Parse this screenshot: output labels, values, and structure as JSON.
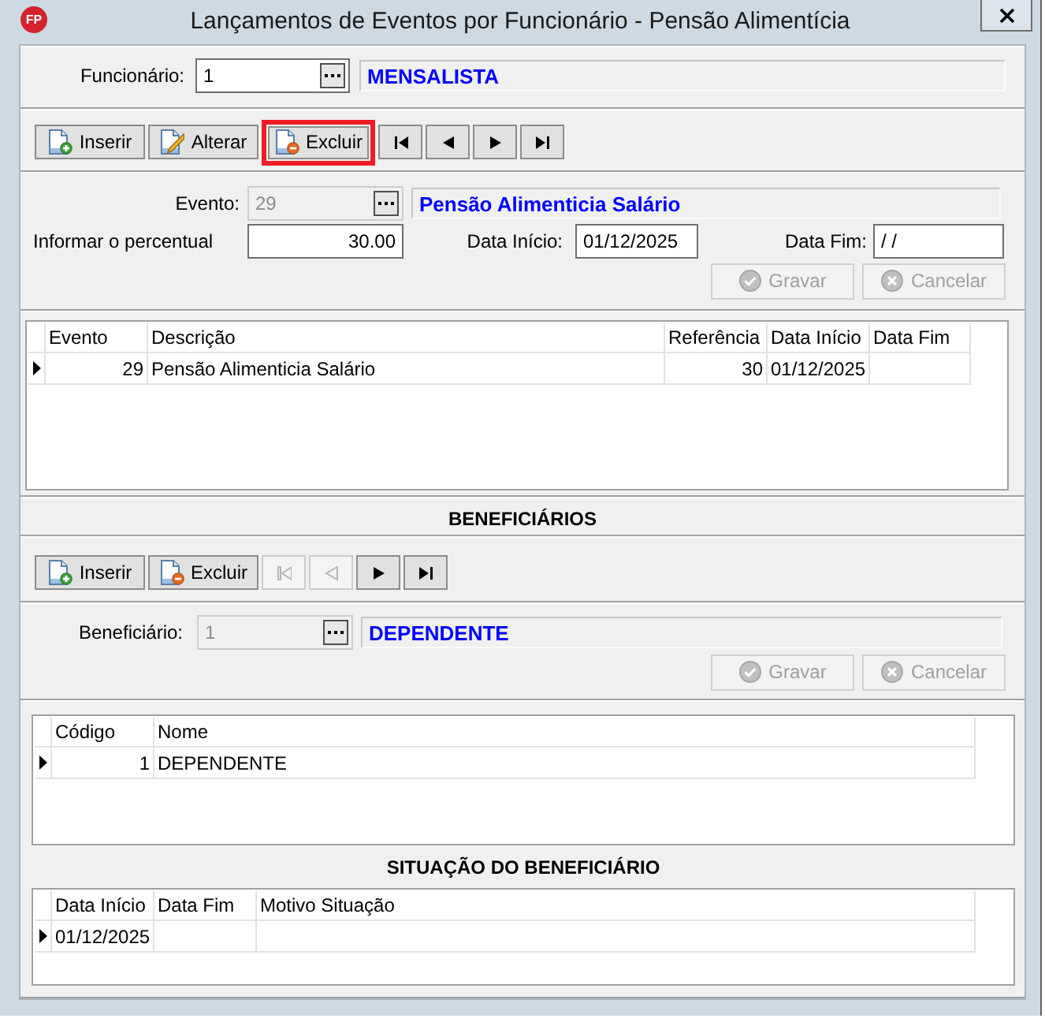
{
  "window": {
    "logo": "FP",
    "title": "Lançamentos de Eventos por Funcionário - Pensão Alimentícia"
  },
  "employee": {
    "label": "Funcionário:",
    "value": "1",
    "disabled": false,
    "description": "MENSALISTA"
  },
  "toolbar": [
    {
      "kind": "insert",
      "label": "Inserir",
      "disabled": false,
      "highlighted": false
    },
    {
      "kind": "edit",
      "label": "Alterar",
      "disabled": false,
      "highlighted": false
    },
    {
      "kind": "delete",
      "label": "Excluir",
      "disabled": false,
      "highlighted": true
    },
    {
      "kind": "first",
      "disabled": false,
      "highlighted": false
    },
    {
      "kind": "prev",
      "disabled": false,
      "highlighted": false
    },
    {
      "kind": "next",
      "disabled": false,
      "highlighted": false
    },
    {
      "kind": "last",
      "disabled": false,
      "highlighted": false
    }
  ],
  "event_form": {
    "event": {
      "label": "Evento:",
      "value": "29",
      "disabled": true,
      "description": "Pensão Alimenticia Salário"
    },
    "percent": {
      "label": "Informar o percentual",
      "value": "30.00"
    },
    "start_date": {
      "label": "Data Início:",
      "value": "01/12/2025"
    },
    "end_date": {
      "label": "Data Fim:",
      "value": "/ /"
    },
    "buttons": [
      {
        "kind": "save",
        "label": "Gravar",
        "disabled": true
      },
      {
        "kind": "cancel",
        "label": "Cancelar",
        "disabled": true
      }
    ]
  },
  "events_table": {
    "columns": [
      {
        "label": "Evento",
        "kind": "number"
      },
      {
        "label": "Descrição",
        "kind": "text"
      },
      {
        "label": "Referência",
        "kind": "number"
      },
      {
        "label": "Data Início",
        "kind": "text"
      },
      {
        "label": "Data Fim",
        "kind": "text"
      }
    ],
    "rows": [
      {
        "selected": true,
        "cells": [
          "29",
          "Pensão Alimenticia Salário",
          "30",
          "01/12/2025"
        ]
      }
    ]
  },
  "beneficiaries": {
    "title": "BENEFICIÁRIOS",
    "toolbar": [
      {
        "kind": "insert",
        "label": "Inserir",
        "disabled": false
      },
      {
        "kind": "delete",
        "label": "Excluir",
        "disabled": false
      },
      {
        "kind": "first",
        "disabled": true
      },
      {
        "kind": "prev",
        "disabled": true
      },
      {
        "kind": "next",
        "disabled": false
      },
      {
        "kind": "last",
        "disabled": false
      }
    ],
    "beneficiary": {
      "label": "Beneficiário:",
      "value": "1",
      "disabled": true,
      "description": "DEPENDENTE"
    },
    "buttons": [
      {
        "kind": "save",
        "label": "Gravar",
        "disabled": true
      },
      {
        "kind": "cancel",
        "label": "Cancelar",
        "disabled": true
      }
    ],
    "table": {
      "columns": [
        {
          "label": "Código",
          "kind": "number"
        },
        {
          "label": "Nome",
          "kind": "text"
        }
      ],
      "rows": [
        {
          "selected": true,
          "cells": [
            "1",
            "DEPENDENTE"
          ]
        }
      ]
    }
  },
  "beneficiary_status": {
    "title": "SITUAÇÃO DO BENEFICIÁRIO",
    "table": {
      "columns": [
        {
          "label": "Data Início"
        },
        {
          "label": "Data Fim"
        },
        {
          "label": "Motivo Situação"
        }
      ],
      "rows": [
        {
          "selected": true,
          "cells": [
            "01/12/2025"
          ]
        }
      ]
    }
  }
}
